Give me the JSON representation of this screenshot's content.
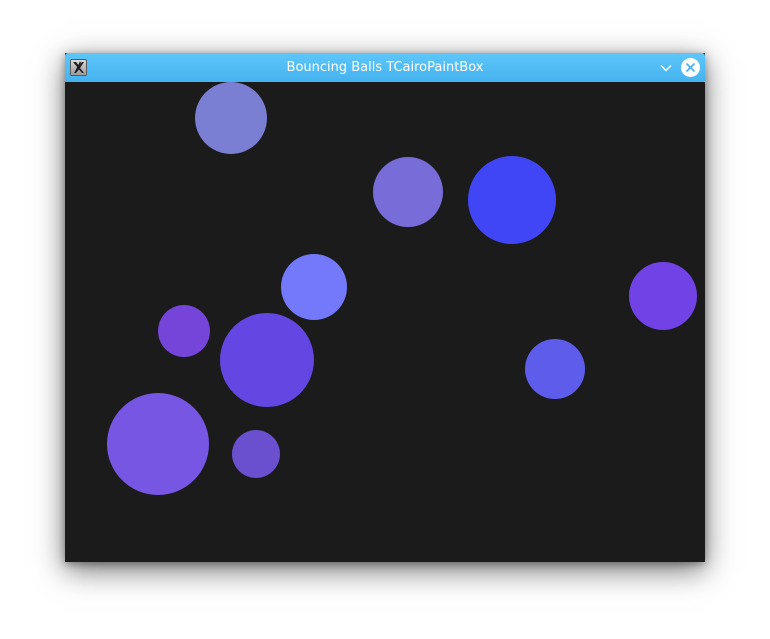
{
  "window": {
    "title": "Bouncing Balls TCairoPaintBox",
    "app_icon": "x11-icon",
    "minimize_icon": "chevron-down-icon",
    "close_icon": "close-icon"
  },
  "canvas": {
    "background": "#1b1b1b",
    "balls": [
      {
        "color": "#7b7fd4"
      },
      {
        "color": "#786cd9"
      },
      {
        "color": "#4046f5"
      },
      {
        "color": "#7478fb"
      },
      {
        "color": "#7142e6"
      },
      {
        "color": "#7544d8"
      },
      {
        "color": "#6447e2"
      },
      {
        "color": "#5e5deb"
      },
      {
        "color": "#7656e3"
      },
      {
        "color": "#6a4fcf"
      }
    ]
  }
}
